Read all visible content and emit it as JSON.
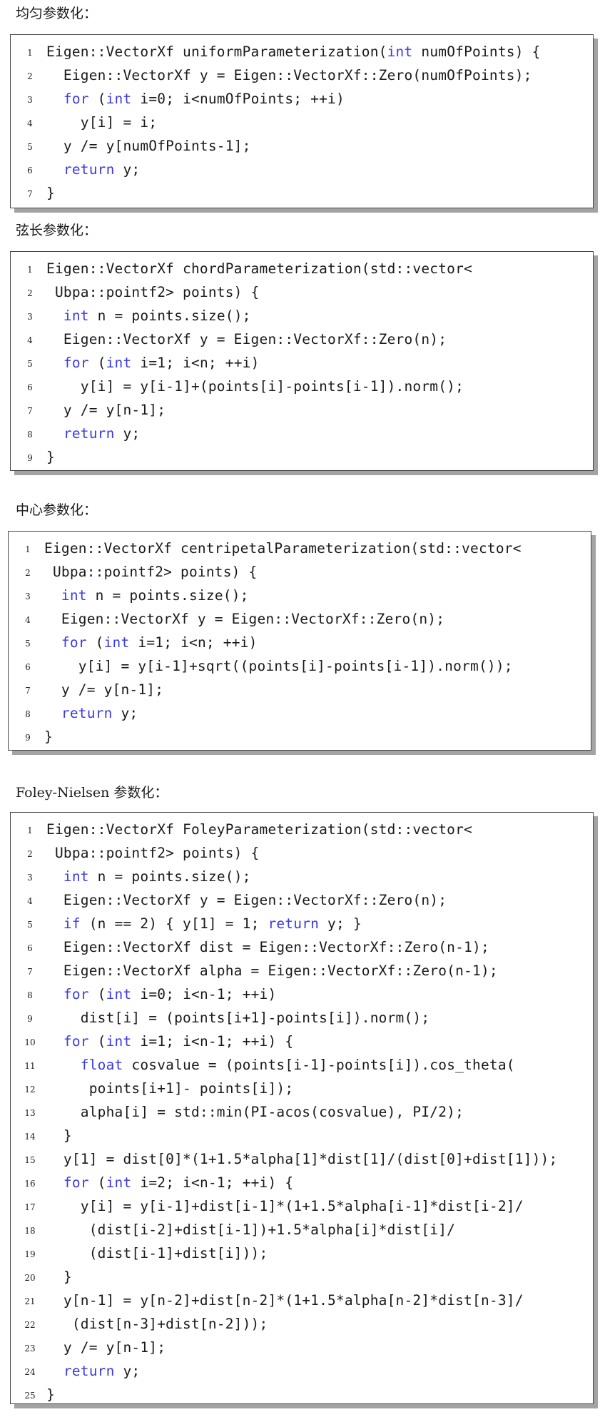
{
  "sections": [
    {
      "heading": "均匀参数化：",
      "lines": [
        [
          [
            "",
            "Eigen::VectorXf uniformParameterization("
          ],
          [
            "kw",
            "int"
          ],
          [
            "",
            " numOfPoints) {"
          ]
        ],
        [
          [
            "",
            "  Eigen::VectorXf y = Eigen::VectorXf::Zero(numOfPoints);"
          ]
        ],
        [
          [
            "",
            "  "
          ],
          [
            "kw",
            "for"
          ],
          [
            "",
            " ("
          ],
          [
            "kw",
            "int"
          ],
          [
            "",
            " i=0; i<numOfPoints; ++i)"
          ]
        ],
        [
          [
            "",
            "    y[i] = i;"
          ]
        ],
        [
          [
            "",
            "  y /= y[numOfPoints-1];"
          ]
        ],
        [
          [
            "",
            "  "
          ],
          [
            "kw",
            "return"
          ],
          [
            "",
            " y;"
          ]
        ],
        [
          [
            "",
            "}"
          ]
        ]
      ]
    },
    {
      "heading": "弦长参数化：",
      "lines": [
        [
          [
            "",
            "Eigen::VectorXf chordParameterization(std::vector<"
          ]
        ],
        [
          [
            "",
            " Ubpa::pointf2> points) {"
          ]
        ],
        [
          [
            "",
            "  "
          ],
          [
            "kw",
            "int"
          ],
          [
            "",
            " n = points.size();"
          ]
        ],
        [
          [
            "",
            "  Eigen::VectorXf y = Eigen::VectorXf::Zero(n);"
          ]
        ],
        [
          [
            "",
            "  "
          ],
          [
            "kw",
            "for"
          ],
          [
            "",
            " ("
          ],
          [
            "kw",
            "int"
          ],
          [
            "",
            " i=1; i<n; ++i)"
          ]
        ],
        [
          [
            "",
            "    y[i] = y[i-1]+(points[i]-points[i-1]).norm();"
          ]
        ],
        [
          [
            "",
            "  y /= y[n-1];"
          ]
        ],
        [
          [
            "",
            "  "
          ],
          [
            "kw",
            "return"
          ],
          [
            "",
            " y;"
          ]
        ],
        [
          [
            "",
            "}"
          ]
        ]
      ]
    },
    {
      "heading": "中心参数化：",
      "lines": [
        [
          [
            "",
            "Eigen::VectorXf centripetalParameterization(std::vector<"
          ]
        ],
        [
          [
            "",
            " Ubpa::pointf2> points) {"
          ]
        ],
        [
          [
            "",
            "  "
          ],
          [
            "kw",
            "int"
          ],
          [
            "",
            " n = points.size();"
          ]
        ],
        [
          [
            "",
            "  Eigen::VectorXf y = Eigen::VectorXf::Zero(n);"
          ]
        ],
        [
          [
            "",
            "  "
          ],
          [
            "kw",
            "for"
          ],
          [
            "",
            " ("
          ],
          [
            "kw",
            "int"
          ],
          [
            "",
            " i=1; i<n; ++i)"
          ]
        ],
        [
          [
            "",
            "    y[i] = y[i-1]+sqrt((points[i]-points[i-1]).norm());"
          ]
        ],
        [
          [
            "",
            "  y /= y[n-1];"
          ]
        ],
        [
          [
            "",
            "  "
          ],
          [
            "kw",
            "return"
          ],
          [
            "",
            " y;"
          ]
        ],
        [
          [
            "",
            "}"
          ]
        ]
      ]
    },
    {
      "heading": "Foley-Nielsen 参数化：",
      "lines": [
        [
          [
            "",
            "Eigen::VectorXf FoleyParameterization(std::vector<"
          ]
        ],
        [
          [
            "",
            " Ubpa::pointf2> points) {"
          ]
        ],
        [
          [
            "",
            "  "
          ],
          [
            "kw",
            "int"
          ],
          [
            "",
            " n = points.size();"
          ]
        ],
        [
          [
            "",
            "  Eigen::VectorXf y = Eigen::VectorXf::Zero(n);"
          ]
        ],
        [
          [
            "",
            "  "
          ],
          [
            "kw",
            "if"
          ],
          [
            "",
            " (n == 2) { y[1] = 1; "
          ],
          [
            "kw",
            "return"
          ],
          [
            "",
            " y; }"
          ]
        ],
        [
          [
            "",
            "  Eigen::VectorXf dist = Eigen::VectorXf::Zero(n-1);"
          ]
        ],
        [
          [
            "",
            "  Eigen::VectorXf alpha = Eigen::VectorXf::Zero(n-1);"
          ]
        ],
        [
          [
            "",
            "  "
          ],
          [
            "kw",
            "for"
          ],
          [
            "",
            " ("
          ],
          [
            "kw",
            "int"
          ],
          [
            "",
            " i=0; i<n-1; ++i)"
          ]
        ],
        [
          [
            "",
            "    dist[i] = (points[i+1]-points[i]).norm();"
          ]
        ],
        [
          [
            "",
            "  "
          ],
          [
            "kw",
            "for"
          ],
          [
            "",
            " ("
          ],
          [
            "kw",
            "int"
          ],
          [
            "",
            " i=1; i<n-1; ++i) {"
          ]
        ],
        [
          [
            "",
            "    "
          ],
          [
            "kw",
            "float"
          ],
          [
            "",
            " cosvalue = (points[i-1]-points[i]).cos_theta("
          ]
        ],
        [
          [
            "",
            "     points[i+1]- points[i]);"
          ]
        ],
        [
          [
            "",
            "    alpha[i] = std::min(PI-acos(cosvalue), PI/2);"
          ]
        ],
        [
          [
            "",
            "  }"
          ]
        ],
        [
          [
            "",
            "  y[1] = dist[0]*(1+1.5*alpha[1]*dist[1]/(dist[0]+dist[1]));"
          ]
        ],
        [
          [
            "",
            "  "
          ],
          [
            "kw",
            "for"
          ],
          [
            "",
            " ("
          ],
          [
            "kw",
            "int"
          ],
          [
            "",
            " i=2; i<n-1; ++i) {"
          ]
        ],
        [
          [
            "",
            "    y[i] = y[i-1]+dist[i-1]*(1+1.5*alpha[i-1]*dist[i-2]/"
          ]
        ],
        [
          [
            "",
            "     (dist[i-2]+dist[i-1])+1.5*alpha[i]*dist[i]/"
          ]
        ],
        [
          [
            "",
            "     (dist[i-1]+dist[i]));"
          ]
        ],
        [
          [
            "",
            "  }"
          ]
        ],
        [
          [
            "",
            "  y[n-1] = y[n-2]+dist[n-2]*(1+1.5*alpha[n-2]*dist[n-3]/"
          ]
        ],
        [
          [
            "",
            "   (dist[n-3]+dist[n-2]));"
          ]
        ],
        [
          [
            "",
            "  y /= y[n-1];"
          ]
        ],
        [
          [
            "",
            "  "
          ],
          [
            "kw",
            "return"
          ],
          [
            "",
            " y;"
          ]
        ],
        [
          [
            "",
            "}"
          ]
        ]
      ]
    }
  ]
}
